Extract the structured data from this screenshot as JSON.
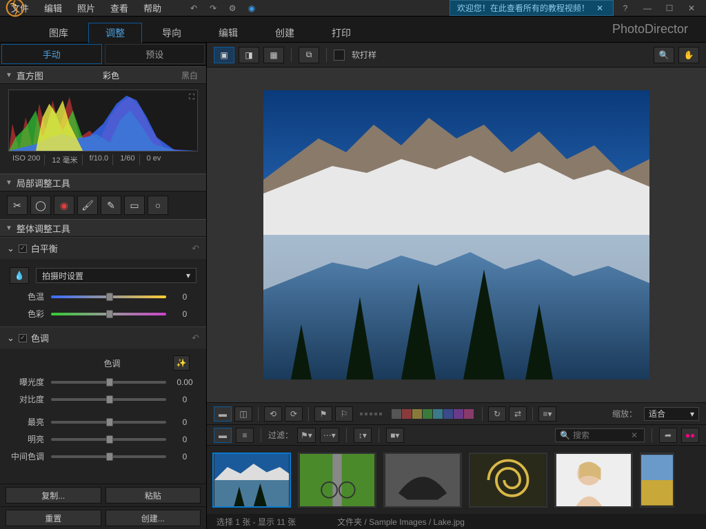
{
  "menubar": {
    "items": [
      "文件",
      "编辑",
      "照片",
      "查看",
      "帮助"
    ]
  },
  "banner": {
    "text": "欢迎您！在此查看所有的教程视频！"
  },
  "brand": "PhotoDirector",
  "moduleTabs": {
    "items": [
      "图库",
      "调整",
      "导向",
      "编辑",
      "创建",
      "打印"
    ],
    "active": 1
  },
  "subTabs": {
    "items": [
      "手动",
      "预设"
    ],
    "active": 0
  },
  "histogram": {
    "title": "直方图",
    "modes": [
      "彩色",
      "黑白"
    ],
    "activeMode": 0
  },
  "camera": {
    "iso": "ISO 200",
    "focal": "12 毫米",
    "aperture": "f/10.0",
    "shutter": "1/60",
    "ev": "0 ev"
  },
  "localTools": {
    "title": "局部调整工具"
  },
  "globalTools": {
    "title": "整体调整工具"
  },
  "whiteBalance": {
    "title": "白平衡",
    "preset": "拍摄时设置",
    "sliders": [
      {
        "label": "色温",
        "value": "0"
      },
      {
        "label": "色彩",
        "value": "0"
      }
    ]
  },
  "tone": {
    "title": "色调",
    "subtitle": "色调",
    "sliders": [
      {
        "label": "曝光度",
        "value": "0.00"
      },
      {
        "label": "对比度",
        "value": "0"
      },
      {
        "label": "最亮",
        "value": "0"
      },
      {
        "label": "明亮",
        "value": "0"
      },
      {
        "label": "中间色调",
        "value": "0"
      }
    ]
  },
  "sideButtons": {
    "copy": "复制...",
    "paste": "粘贴",
    "reset": "重置",
    "create": "创建..."
  },
  "viewerTop": {
    "softProof": "软打样"
  },
  "lowerBar": {
    "zoomLabel": "缩放：",
    "zoomValue": "适合"
  },
  "filterBar": {
    "filterLabel": "过滤：",
    "searchPlaceholder": "搜索"
  },
  "status": {
    "selection": "选择 1 张 - 显示 11 张",
    "path": "文件夹 / Sample Images / Lake.jpg"
  },
  "swatchColors": [
    "#555",
    "#8a3a3a",
    "#8a7a3a",
    "#3a7a3a",
    "#3a7a8a",
    "#3a4a8a",
    "#6a3a8a",
    "#8a3a6a"
  ]
}
